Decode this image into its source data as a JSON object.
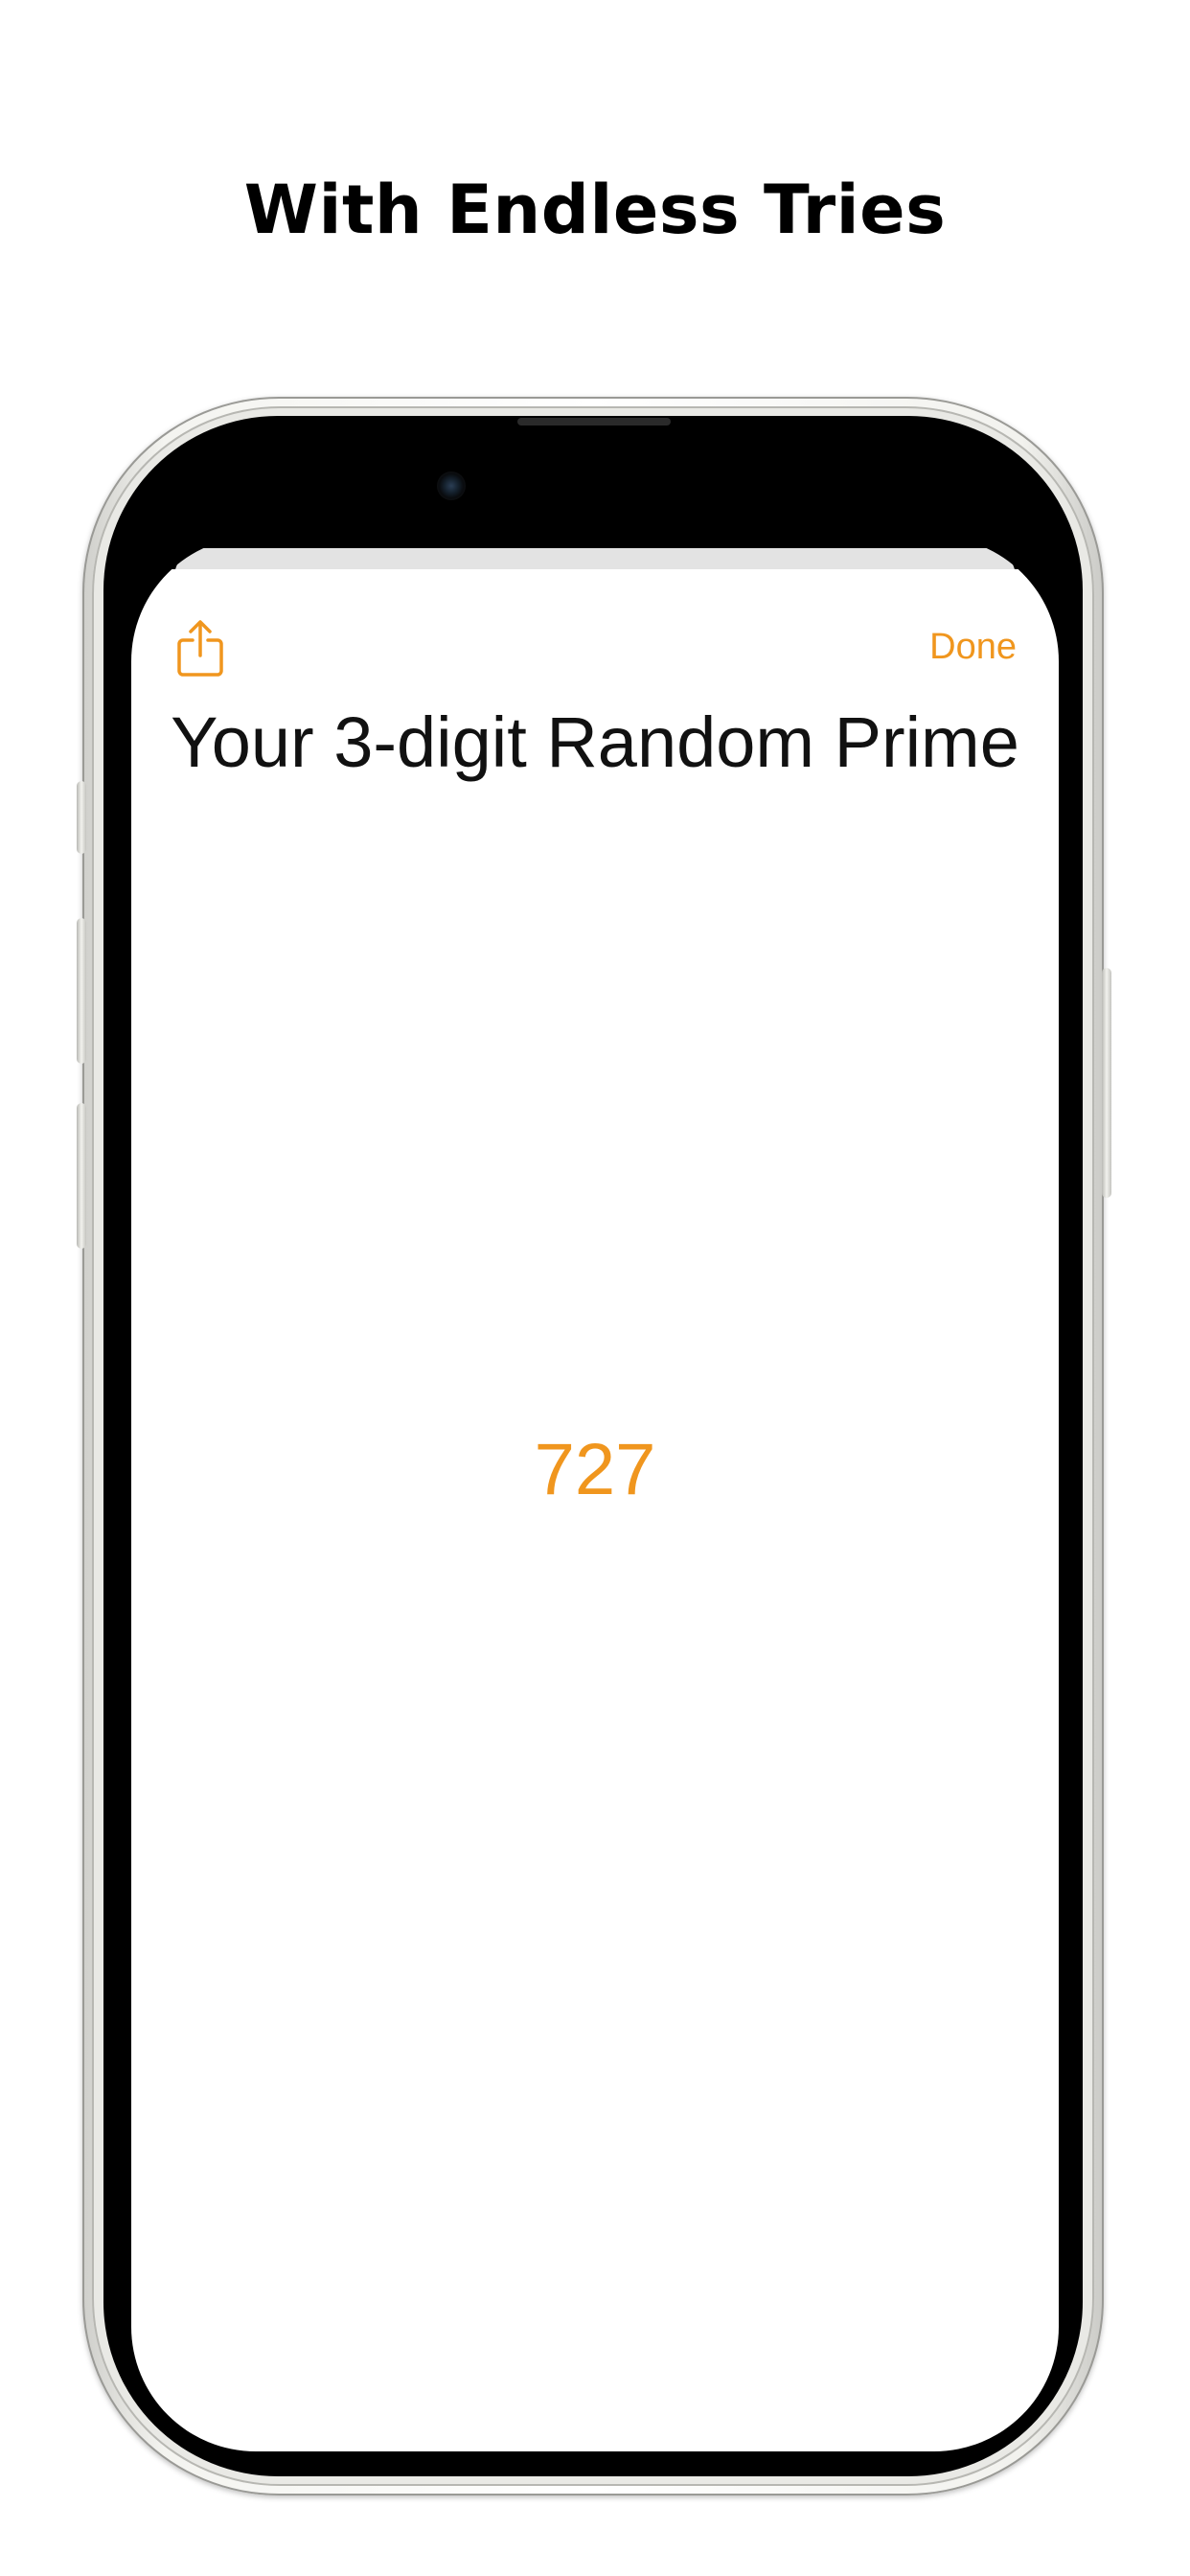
{
  "headline": "With Endless Tries",
  "sheet": {
    "title": "Your 3-digit Random Prime",
    "done_label": "Done",
    "share_icon": "share-icon",
    "value": "727"
  },
  "colors": {
    "accent": "#f0961e",
    "background": "#ffffff",
    "title_text": "#111111"
  }
}
